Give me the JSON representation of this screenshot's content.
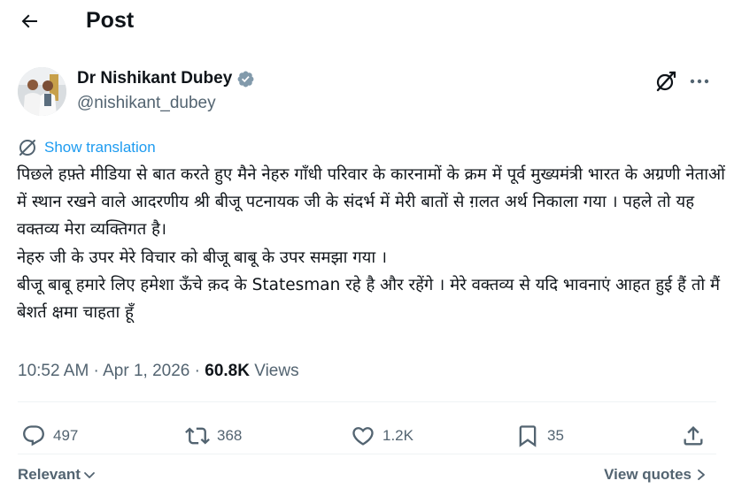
{
  "header": {
    "title": "Post",
    "back_icon": "arrow-left-icon"
  },
  "author": {
    "name": "Dr Nishikant Dubey",
    "handle": "@nishikant_dubey",
    "verified_icon": "verified-badge-icon",
    "verified_color": "#829aab"
  },
  "translate": {
    "label": "Show translation",
    "icon": "translate-icon",
    "color": "#1d9bf0"
  },
  "tweet": {
    "text": "पिछले हफ़्ते मीडिया से बात करते हुए मैने नेहरु गॉंधी परिवार के कारनामों के क्रम में पूर्व मुख्यमंत्री भारत के अग्रणी नेताओं में स्थान रखने वाले आदरणीय श्री बीजू पटनायक जी के संदर्भ में मेरी बातों से ग़लत अर्थ निकाला गया । पहले तो यह वक्तव्य मेरा व्यक्तिगत है।\nनेहरु जी के उपर मेरे विचार को बीजू बाबू के उपर समझा गया ।\nबीजू बाबू हमारे लिए हमेशा ऊँचे क़द के Statesman रहे है और रहेंगे । मेरे वक्तव्य से यदि भावनाएं आहत हुई हैं तो मैं बेशर्त क्षमा चाहता हूँ"
  },
  "meta": {
    "time": "10:52 AM",
    "sep1": " · ",
    "date": "Apr 1, 2026",
    "sep2": " · ",
    "views_count": "60.8K",
    "views_label": " Views"
  },
  "actions": {
    "replies": {
      "icon": "reply-icon",
      "count": "497"
    },
    "reposts": {
      "icon": "repost-icon",
      "count": "368"
    },
    "likes": {
      "icon": "heart-icon",
      "count": "1.2K"
    },
    "bookmarks": {
      "icon": "bookmark-icon",
      "count": "35"
    },
    "share": {
      "icon": "share-icon"
    }
  },
  "footer": {
    "sort_label": "Relevant",
    "view_quotes_label": "View quotes"
  },
  "colors": {
    "text": "#0f1419",
    "muted": "#536471",
    "accent": "#1d9bf0",
    "divider": "#eff3f4"
  }
}
